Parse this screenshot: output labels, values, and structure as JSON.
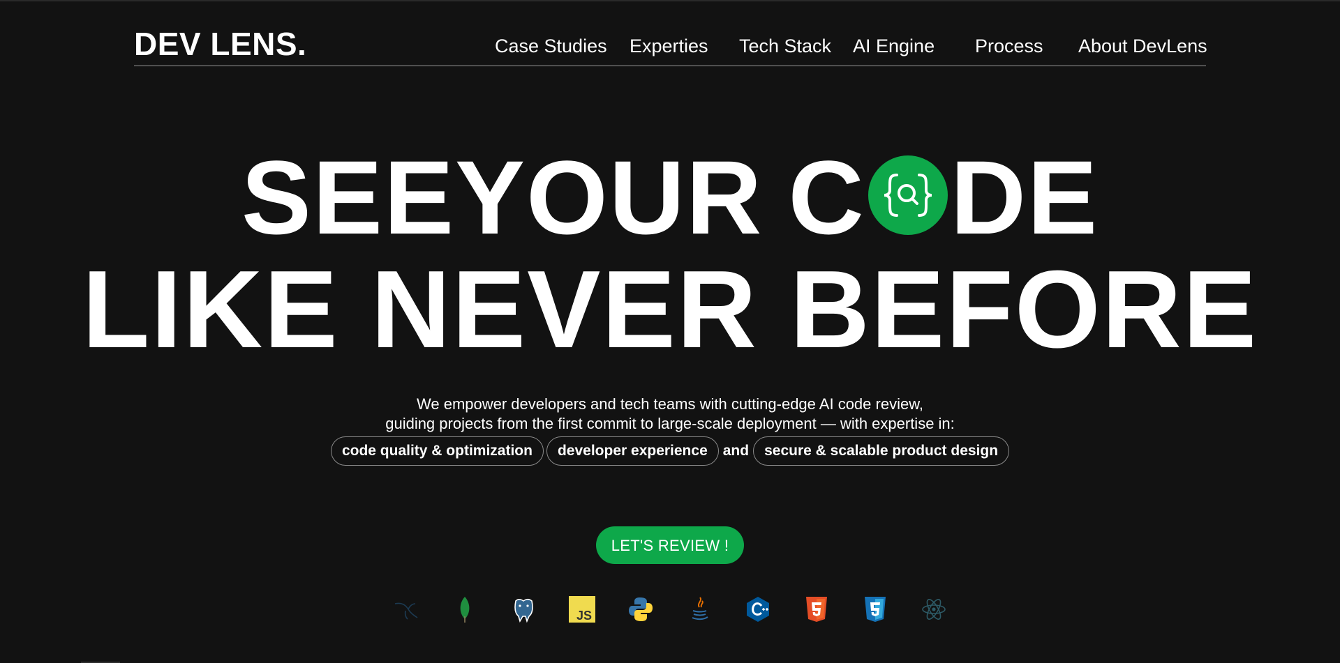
{
  "brand": {
    "logo": "DEV LENS."
  },
  "nav": {
    "items": [
      {
        "label": "Case Studies"
      },
      {
        "label": "Experties"
      },
      {
        "label": "Tech Stack"
      },
      {
        "label": "AI Engine"
      },
      {
        "label": "Process"
      },
      {
        "label": "About DevLens"
      }
    ]
  },
  "hero": {
    "line1": {
      "word1": "SEE",
      "word2": "YOUR",
      "word3_before": "C",
      "word3_after": "DE"
    },
    "line2": "LIKE NEVER BEFORE",
    "subtitle_line1": "We empower developers and tech teams with cutting-edge AI code review,",
    "subtitle_line2": "guiding projects from the first commit to large-scale deployment — with expertise in:",
    "pills": [
      "code quality & optimization",
      "developer experience",
      "secure & scalable product design"
    ],
    "pill_connector": "and",
    "cta_label": "LET'S REVIEW !"
  },
  "tech_stack": {
    "icons": [
      "mysql-icon",
      "mongodb-icon",
      "postgresql-icon",
      "javascript-icon",
      "python-icon",
      "java-icon",
      "cplusplus-icon",
      "html5-icon",
      "css3-icon",
      "react-icon"
    ],
    "js_badge": "JS"
  },
  "colors": {
    "background": "#121212",
    "accent": "#0ea84a",
    "text": "#ffffff"
  }
}
